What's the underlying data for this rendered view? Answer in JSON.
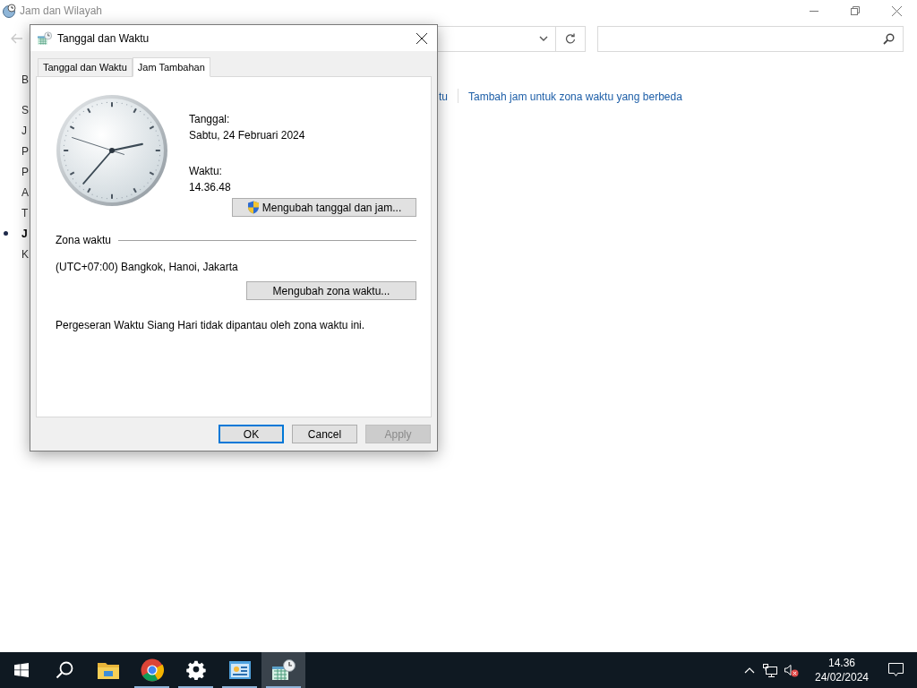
{
  "background_window": {
    "title": "Jam dan Wilayah",
    "sidebar_heading": "B",
    "sidebar_items": [
      {
        "text": "S",
        "selected": false
      },
      {
        "text": "J",
        "selected": false
      },
      {
        "text": "P",
        "selected": false
      },
      {
        "text": "P",
        "selected": false
      },
      {
        "text": "A",
        "selected": false
      },
      {
        "text": "T",
        "selected": false
      },
      {
        "text": "J",
        "selected": true
      },
      {
        "text": "K",
        "selected": false
      }
    ],
    "links": [
      "tu",
      "Tambah jam untuk zona waktu yang berbeda"
    ]
  },
  "dialog": {
    "title": "Tanggal dan Waktu",
    "tabs": [
      {
        "label": "Tanggal dan Waktu",
        "selected": false
      },
      {
        "label": "Jam Tambahan",
        "selected": true
      }
    ],
    "date_label": "Tanggal:",
    "date_value": "Sabtu, 24 Februari 2024",
    "time_label": "Waktu:",
    "time_value": "14.36.48",
    "change_datetime_button": "Mengubah tanggal dan jam...",
    "timezone_heading": "Zona waktu",
    "timezone_value": "(UTC+07:00) Bangkok, Hanoi, Jakarta",
    "change_timezone_button": "Mengubah zona waktu...",
    "dst_note": "Pergeseran Waktu Siang Hari tidak dipantau oleh zona waktu ini.",
    "buttons": [
      {
        "label": "OK",
        "disabled": false,
        "default": true
      },
      {
        "label": "Cancel",
        "disabled": false,
        "default": false
      },
      {
        "label": "Apply",
        "disabled": true,
        "default": false
      }
    ]
  },
  "taskbar": {
    "apps": [
      {
        "kind": "explorer",
        "running": false,
        "selected": false
      },
      {
        "kind": "chrome",
        "running": true,
        "selected": false
      },
      {
        "kind": "settings",
        "running": true,
        "selected": false
      },
      {
        "kind": "control-panel",
        "running": true,
        "selected": false
      },
      {
        "kind": "datetime",
        "running": true,
        "selected": true
      }
    ],
    "time": "14.36",
    "date": "24/02/2024"
  }
}
